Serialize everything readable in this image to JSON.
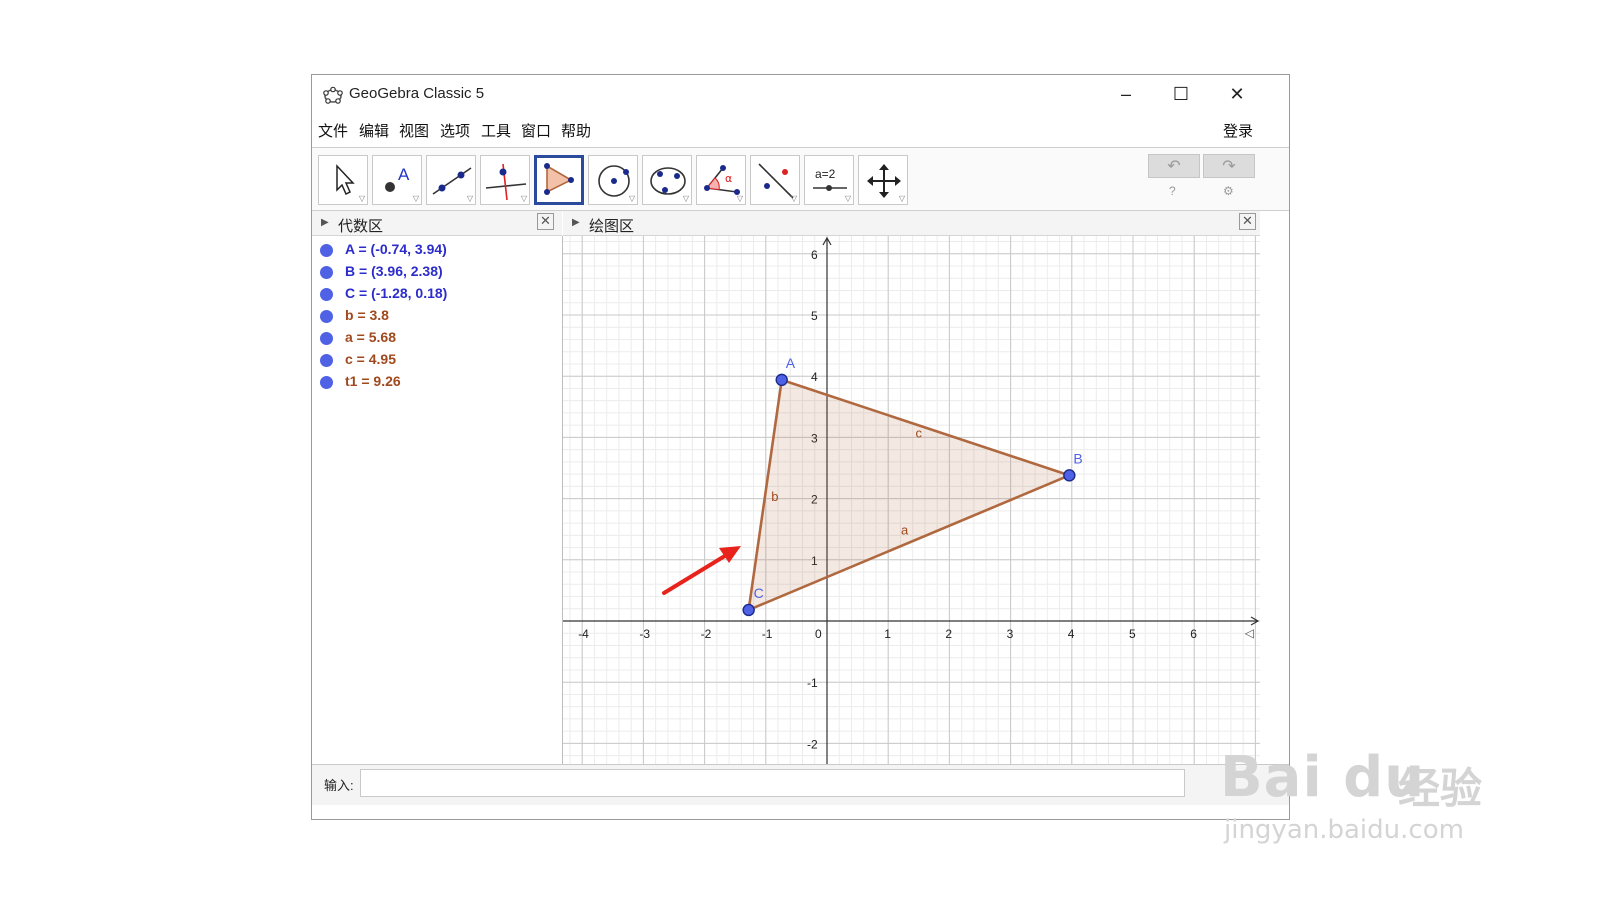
{
  "window": {
    "title": "GeoGebra Classic 5",
    "minimize_glyph": "–",
    "maximize_glyph": "☐",
    "close_glyph": "✕"
  },
  "menu": {
    "items": [
      "文件",
      "编辑",
      "视图",
      "选项",
      "工具",
      "窗口",
      "帮助"
    ],
    "login": "登录"
  },
  "toolbar": {
    "tools": [
      {
        "name": "move-tool-icon"
      },
      {
        "name": "point-tool-icon",
        "label": "A"
      },
      {
        "name": "line-tool-icon"
      },
      {
        "name": "perpendicular-tool-icon"
      },
      {
        "name": "polygon-tool-icon",
        "selected": true
      },
      {
        "name": "circle-tool-icon"
      },
      {
        "name": "conic-tool-icon"
      },
      {
        "name": "angle-tool-icon",
        "label": "α"
      },
      {
        "name": "reflect-tool-icon"
      },
      {
        "name": "slider-tool-icon",
        "label": "a=2"
      },
      {
        "name": "move-graphics-tool-icon"
      }
    ],
    "undo_glyph": "↶",
    "redo_glyph": "↷",
    "help_glyph": "?",
    "settings_glyph": "⚙"
  },
  "algebra": {
    "title": "代数区",
    "items": [
      {
        "text": "A = (-0.74, 3.94)",
        "color": "#2c2ccc"
      },
      {
        "text": "B = (3.96, 2.38)",
        "color": "#2c2ccc"
      },
      {
        "text": "C = (-1.28, 0.18)",
        "color": "#2c2ccc"
      },
      {
        "text": "b = 3.8",
        "color": "#a0491e"
      },
      {
        "text": "a = 5.68",
        "color": "#a0491e"
      },
      {
        "text": "c = 4.95",
        "color": "#a0491e"
      },
      {
        "text": "t1 = 9.26",
        "color": "#a0491e"
      }
    ]
  },
  "graphics": {
    "title": "绘图区",
    "x_ticks": [
      "-4",
      "-3",
      "-2",
      "-1",
      "0",
      "1",
      "2",
      "3",
      "4",
      "5",
      "6"
    ],
    "y_ticks": [
      "6",
      "5",
      "4",
      "3",
      "2",
      "1",
      "-1",
      "-2"
    ],
    "points": [
      {
        "label": "A",
        "x": -0.74,
        "y": 3.94
      },
      {
        "label": "B",
        "x": 3.96,
        "y": 2.38
      },
      {
        "label": "C",
        "x": -1.28,
        "y": 0.18
      }
    ],
    "segments": [
      {
        "label": "c"
      },
      {
        "label": "a"
      },
      {
        "label": "b"
      }
    ],
    "point_color": "#4f62e6",
    "polygon_color": "#b0683f"
  },
  "input": {
    "label": "输入:",
    "value": ""
  },
  "watermark": {
    "logo": "Bai du",
    "cn": "经验",
    "url": "jingyan.baidu.com"
  }
}
